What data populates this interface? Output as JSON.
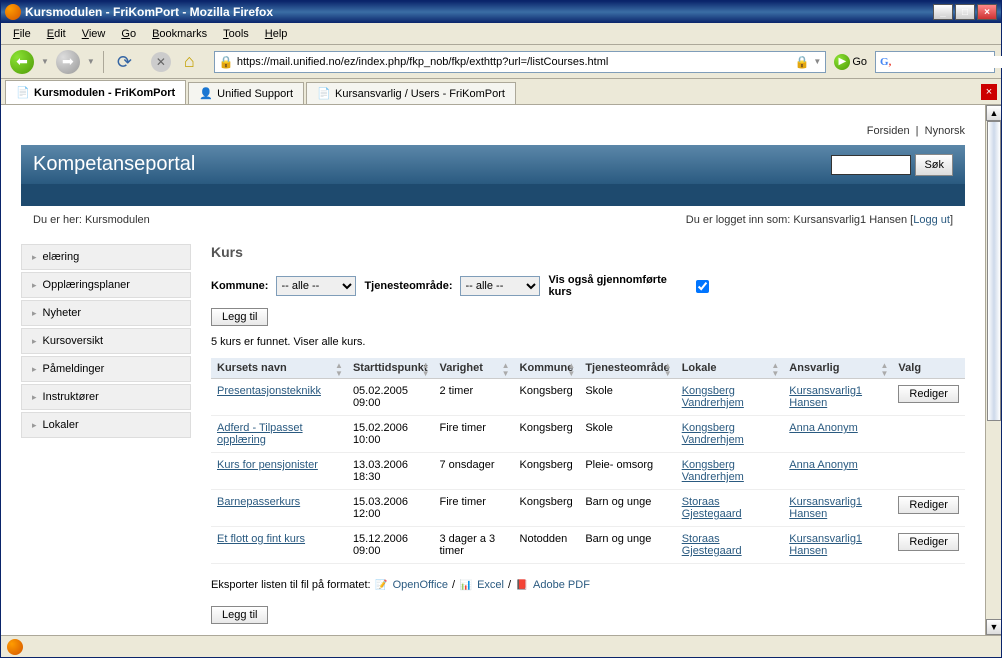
{
  "window": {
    "title": "Kursmodulen - FriKomPort - Mozilla Firefox"
  },
  "menubar": {
    "file": "File",
    "edit": "Edit",
    "view": "View",
    "go": "Go",
    "bookmarks": "Bookmarks",
    "tools": "Tools",
    "help": "Help"
  },
  "toolbar": {
    "url": "https://mail.unified.no/ez/index.php/fkp_nob/fkp/exthttp?url=/listCourses.html",
    "go_label": "Go"
  },
  "tabs": [
    {
      "label": "Kursmodulen - FriKomPort",
      "active": true
    },
    {
      "label": "Unified Support",
      "active": false
    },
    {
      "label": "Kursansvarlig / Users - FriKomPort",
      "active": false
    }
  ],
  "page_top": {
    "forsiden": "Forsiden",
    "nynorsk": "Nynorsk"
  },
  "header": {
    "title": "Kompetanseportal",
    "search_btn": "Søk"
  },
  "breadcrumb": {
    "left_prefix": "Du er her: ",
    "left_current": "Kursmodulen",
    "right_prefix": "Du er logget inn som: ",
    "right_user": "Kursansvarlig1 Hansen",
    "logout": "Logg ut"
  },
  "sidebar": {
    "items": [
      "elæring",
      "Opplæringsplaner",
      "Nyheter",
      "Kursoversikt",
      "Påmeldinger",
      "Instruktører",
      "Lokaler"
    ]
  },
  "main": {
    "heading": "Kurs",
    "kommune_label": "Kommune:",
    "kommune_value": "-- alle --",
    "tjeneste_label": "Tjenesteområde:",
    "tjeneste_value": "-- alle --",
    "vis_label": "Vis også gjennomførte kurs",
    "legg_til": "Legg til",
    "result_text": "5 kurs er funnet. Viser alle kurs.",
    "columns": [
      "Kursets navn",
      "Starttidspunkt",
      "Varighet",
      "Kommune",
      "Tjenesteområde",
      "Lokale",
      "Ansvarlig",
      "Valg"
    ],
    "rows": [
      {
        "navn": "Presentasjonsteknikk",
        "start": "05.02.2005 09:00",
        "varighet": "2 timer",
        "kommune": "Kongsberg",
        "omrade": "Skole",
        "lokale": "Kongsberg Vandrerhjem",
        "ansvarlig": "Kursansvarlig1 Hansen",
        "rediger": "Rediger"
      },
      {
        "navn": "Adferd - Tilpasset opplæring",
        "start": "15.02.2006 10:00",
        "varighet": "Fire timer",
        "kommune": "Kongsberg",
        "omrade": "Skole",
        "lokale": "Kongsberg Vandrerhjem",
        "ansvarlig": "Anna Anonym",
        "rediger": ""
      },
      {
        "navn": "Kurs for pensjonister",
        "start": "13.03.2006 18:30",
        "varighet": "7 onsdager",
        "kommune": "Kongsberg",
        "omrade": "Pleie- omsorg",
        "lokale": "Kongsberg Vandrerhjem",
        "ansvarlig": "Anna Anonym",
        "rediger": ""
      },
      {
        "navn": "Barnepasserkurs",
        "start": "15.03.2006 12:00",
        "varighet": "Fire timer",
        "kommune": "Kongsberg",
        "omrade": "Barn og unge",
        "lokale": "Storaas Gjestegaard",
        "ansvarlig": "Kursansvarlig1 Hansen",
        "rediger": "Rediger"
      },
      {
        "navn": "Et flott og fint kurs",
        "start": "15.12.2006 09:00",
        "varighet": "3 dager a 3 timer",
        "kommune": "Notodden",
        "omrade": "Barn og unge",
        "lokale": "Storaas Gjestegaard",
        "ansvarlig": "Kursansvarlig1 Hansen",
        "rediger": "Rediger"
      }
    ],
    "export_prefix": "Eksporter listen til fil på formatet:",
    "export_oo": "OpenOffice",
    "export_xls": "Excel",
    "export_pdf": "Adobe PDF"
  }
}
